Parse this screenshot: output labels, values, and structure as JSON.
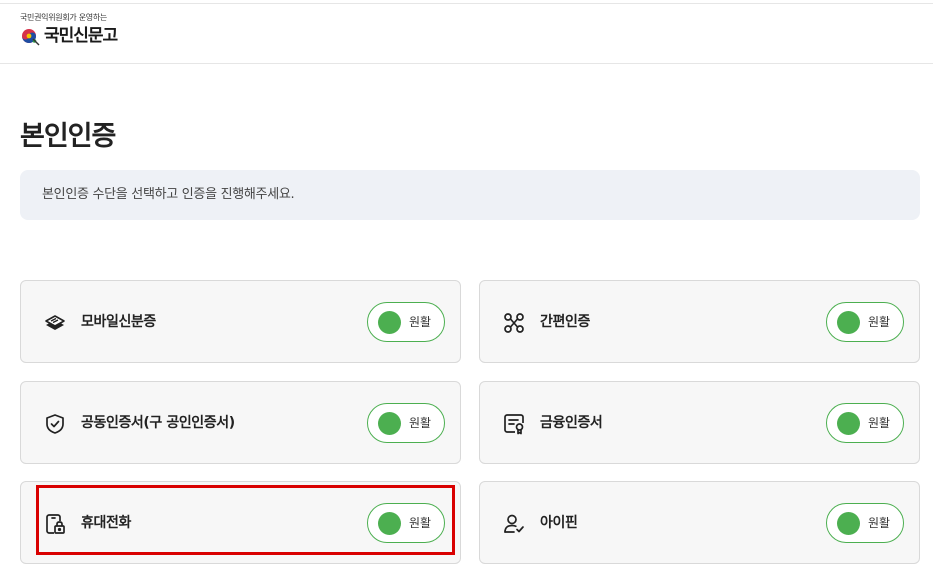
{
  "header": {
    "logo_subtitle": "국민권익위원회가 운영하는",
    "logo_name": "국민신문고"
  },
  "page": {
    "title": "본인인증",
    "notice": "본인인증 수단을 선택하고 인증을 진행해주세요."
  },
  "status_color": "#4caf50",
  "highlight_color": "#d90000",
  "auth_methods": [
    {
      "label": "모바일신분증",
      "status": "원활",
      "icon": "id-card-stack-icon"
    },
    {
      "label": "간편인증",
      "status": "원활",
      "icon": "link-nodes-icon"
    },
    {
      "label": "공동인증서(구 공인인증서)",
      "status": "원활",
      "icon": "shield-check-icon"
    },
    {
      "label": "금융인증서",
      "status": "원활",
      "icon": "certificate-icon"
    },
    {
      "label": "휴대전화",
      "status": "원활",
      "icon": "phone-lock-icon"
    },
    {
      "label": "아이핀",
      "status": "원활",
      "icon": "user-check-icon"
    }
  ]
}
